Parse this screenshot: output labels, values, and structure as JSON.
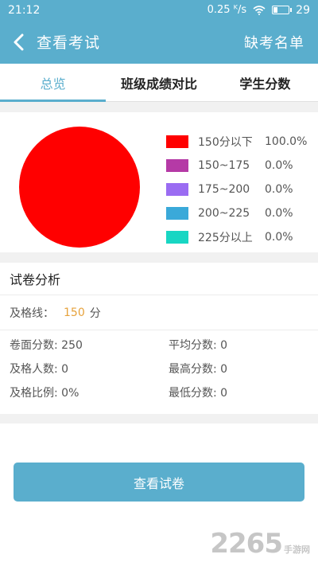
{
  "status_bar": {
    "time": "21:12",
    "network": "0.25 ᴷ/s",
    "battery": "29"
  },
  "header": {
    "title": "查看考试",
    "action": "缺考名单"
  },
  "tabs": [
    {
      "label": "总览",
      "active": true
    },
    {
      "label": "班级成绩对比",
      "active": false
    },
    {
      "label": "学生分数",
      "active": false
    }
  ],
  "chart_data": {
    "type": "pie",
    "categories": [
      "150分以下",
      "150~175",
      "175~200",
      "200~225",
      "225分以上"
    ],
    "values": [
      100.0,
      0.0,
      0.0,
      0.0,
      0.0
    ],
    "labels_pct": [
      "100.0%",
      "0.0%",
      "0.0%",
      "0.0%",
      "0.0%"
    ],
    "colors": [
      "#ff0000",
      "#b53aa6",
      "#9a6cf2",
      "#3aa9d9",
      "#18d6c3"
    ]
  },
  "analysis": {
    "title": "试卷分析",
    "pass_line_label": "及格线：",
    "pass_line_value": "150",
    "pass_line_unit": "分",
    "stats": [
      "卷面分数: 250",
      "平均分数: 0",
      "及格人数: 0",
      "最高分数: 0",
      "及格比例: 0%",
      "最低分数: 0"
    ]
  },
  "view_paper_button": "查看试卷",
  "watermark": {
    "main": "2265",
    "sub": "手游网"
  }
}
